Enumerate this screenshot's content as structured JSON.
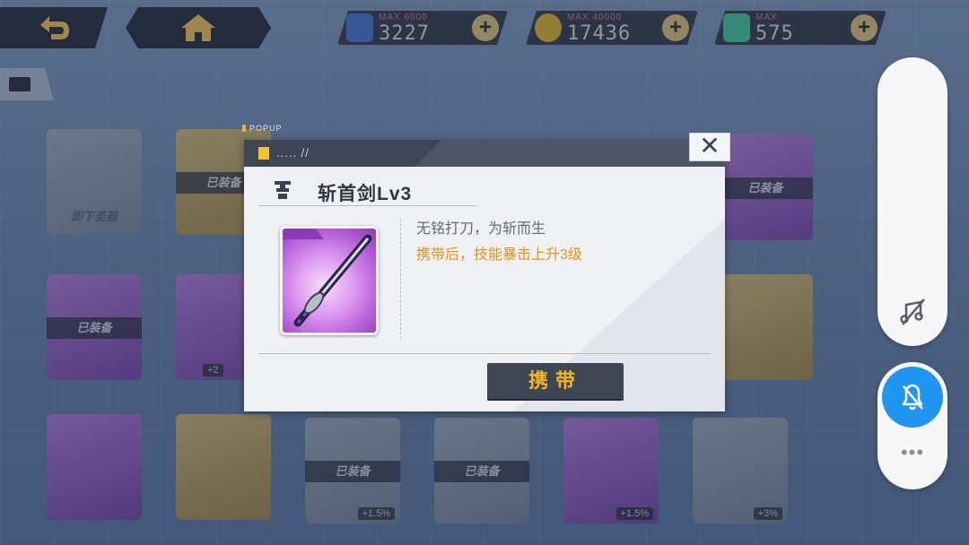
{
  "topbar": {
    "resources": [
      {
        "name": "card-resource",
        "max": "MAX 6000",
        "value": "3227",
        "color": "#4a78c8"
      },
      {
        "name": "coin-resource",
        "max": "MAX 40000",
        "value": "17436",
        "color": "#d9b23c"
      },
      {
        "name": "gem-resource",
        "max": "MAX",
        "value": "575",
        "color": "#47c79a"
      }
    ]
  },
  "background_cards": {
    "equipped_tag": "已装备",
    "unequip_label": "卸下圣器",
    "bonuses": [
      "+2",
      "+1.5%",
      "+1.5%",
      "+3%"
    ]
  },
  "popup": {
    "tag": "POPUP",
    "header_label": "..... //",
    "item_title": "斩首剑Lv3",
    "desc_line1": "无铭打刀，为斩而生",
    "desc_line2": "携带后，技能暴击上升3级",
    "equip_label": "携带",
    "close_symbol": "✕"
  },
  "side_panel": {
    "more_label": "•••"
  },
  "colors": {
    "accent_orange": "#e49218",
    "button_gold": "#f0b62a",
    "bell_blue": "#1f96f2",
    "rarity_purple": "#b55fd8"
  }
}
